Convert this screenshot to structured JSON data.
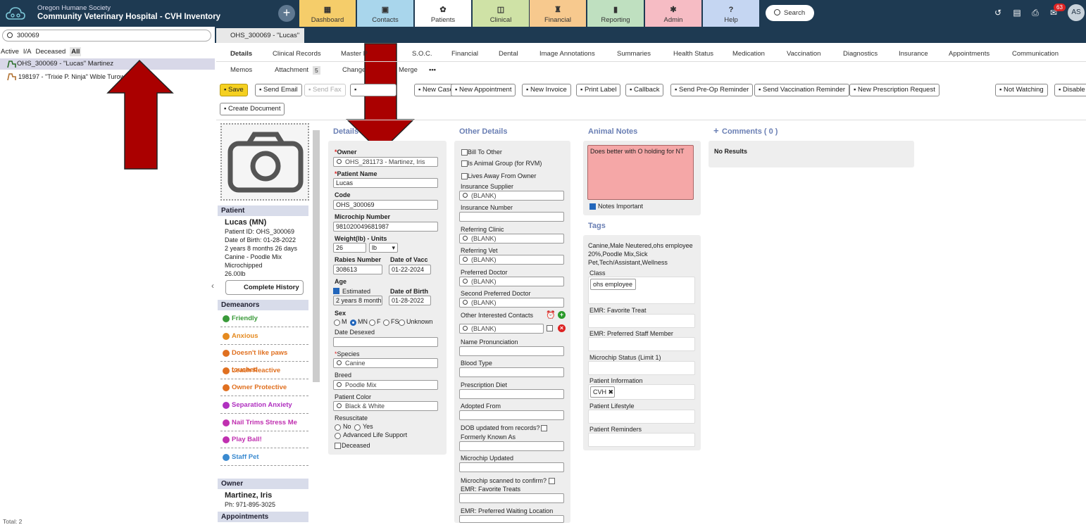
{
  "header": {
    "org": "Oregon Humane Society",
    "hospital": "Community Veterinary Hospital - CVH Inventory",
    "search_label": "Search",
    "badge": "63",
    "avatar": "AS"
  },
  "nav": [
    {
      "label": "Dashboard",
      "icon": "▦",
      "color": "#f5cd6a"
    },
    {
      "label": "Contacts",
      "icon": "▣",
      "color": "#a9d6ec"
    },
    {
      "label": "Patients",
      "icon": "✿",
      "color": "#ffffff"
    },
    {
      "label": "Clinical",
      "icon": "◫",
      "color": "#cfe2a6"
    },
    {
      "label": "Financial",
      "icon": "♜",
      "color": "#f7c98e"
    },
    {
      "label": "Reporting",
      "icon": "▮",
      "color": "#bfe0c0"
    },
    {
      "label": "Admin",
      "icon": "✱",
      "color": "#f6bcc4"
    },
    {
      "label": "Help",
      "icon": "?",
      "color": "#c5d6f2"
    }
  ],
  "left": {
    "search_value": "300069",
    "filters": [
      "Active",
      "I/A",
      "Deceased",
      "All"
    ],
    "results": [
      "OHS_300069 - \"Lucas\" Martinez",
      "198197 - \"Trixie P. Ninja\" Wible Turowski"
    ],
    "total": "Total: 2"
  },
  "patient_tab": "OHS_300069 - \"Lucas\" ...",
  "subtabs_row1": [
    "Details",
    "Clinical Records",
    "Master P",
    "S.O.C.",
    "Financial",
    "Dental",
    "Image Annotations",
    "Summaries",
    "Health Status",
    "Medication",
    "Vaccination",
    "Diagnostics",
    "Insurance",
    "Appointments",
    "Communication"
  ],
  "subtabs_row2": [
    "Memos",
    "Attachment",
    "5",
    "Change",
    "Merge",
    "•••"
  ],
  "toolbar": [
    "Save",
    "Send Email",
    "Send Fax",
    "",
    "New Case",
    "New Appointment",
    "New Invoice",
    "Print Label",
    "Callback",
    "Send Pre-Op Reminder",
    "Send Vaccination Reminder",
    "New Prescription Request",
    "Not Watching",
    "Disable",
    "Create Document"
  ],
  "patient": {
    "section": "Patient",
    "name": "Lucas (MN)",
    "id": "Patient ID: OHS_300069",
    "dob": "Date of Birth: 01-28-2022",
    "age": "2 years 8 months 26 days",
    "breed": "Canine - Poodle Mix",
    "chip": "Microchipped",
    "weight": "26.00lb",
    "history": "Complete History"
  },
  "demeanors": {
    "title": "Demeanors",
    "items": [
      {
        "label": "Friendly",
        "color": "#3a9a3a"
      },
      {
        "label": "Anxious",
        "color": "#e58a1f"
      },
      {
        "label": "Doesn't like paws touched",
        "color": "#e07020"
      },
      {
        "label": "Leash Reactive",
        "color": "#e07020"
      },
      {
        "label": "Owner Protective",
        "color": "#e07020"
      },
      {
        "label": "Separation Anxiety",
        "color": "#b030c0"
      },
      {
        "label": "Nail Trims Stress Me",
        "color": "#c030b0"
      },
      {
        "label": "Play Ball!",
        "color": "#c030b0"
      },
      {
        "label": "Staff Pet",
        "color": "#3a8ad0"
      }
    ]
  },
  "owner": {
    "section": "Owner",
    "name": "Martinez, Iris",
    "phone": "Ph: 971-895-3025",
    "appointments": "Appointments"
  },
  "details": {
    "title": "Details",
    "owner_label": "Owner",
    "owner_value": "OHS_281173 -  Martinez, Iris",
    "name_label": "Patient Name",
    "name_value": "Lucas",
    "code_label": "Code",
    "code_value": "OHS_300069",
    "chip_label": "Microchip Number",
    "chip_value": "981020049681987",
    "weight_label": "Weight(lb) - Units",
    "weight_value": "26",
    "unit_value": "lb",
    "rabies_label": "Rabies Number",
    "rabies_value": "308613",
    "vacc_label": "Date of Vacc",
    "vacc_value": "01-22-2024",
    "age_label": "Age",
    "estimated": "Estimated",
    "age_value": "2 years 8 months",
    "dob_label": "Date of Birth",
    "dob_value": "01-28-2022",
    "sex_label": "Sex",
    "sex": [
      "M",
      "MN",
      "F",
      "FS",
      "Unknown"
    ],
    "desexed_label": "Date Desexed",
    "species_label": "Species",
    "species_value": "Canine",
    "breed_label": "Breed",
    "breed_value": "Poodle Mix",
    "color_label": "Patient Color",
    "color_value": "Black & White",
    "resus_label": "Resuscitate",
    "no": "No",
    "yes": "Yes",
    "als": "Advanced Life Support",
    "deceased": "Deceased"
  },
  "other": {
    "title": "Other Details",
    "bill": "Bill To Other",
    "group": "Is Animal Group (for RVM)",
    "lives": "Lives Away From Owner",
    "ins_sup": "Insurance Supplier",
    "blank": "(BLANK)",
    "ins_num": "Insurance Number",
    "ref_clinic": "Referring Clinic",
    "ref_vet": "Referring Vet",
    "pref_doc": "Preferred Doctor",
    "second_doc": "Second Preferred Doctor",
    "contacts": "Other Interested Contacts",
    "pron": "Name Pronunciation",
    "blood": "Blood Type",
    "diet": "Prescription Diet",
    "adopted": "Adopted From",
    "dob_upd": "DOB updated from records?",
    "formerly": "Formerly Known As",
    "chip_upd": "Microchip Updated",
    "chip_scan": "Microchip scanned to confirm?",
    "fav_treats": "EMR: Favorite Treats",
    "wait_loc": "EMR: Preferred Waiting Location"
  },
  "notes": {
    "title": "Animal Notes",
    "text": "Does better with O holding for NT",
    "important": "Notes Important"
  },
  "tags": {
    "title": "Tags",
    "text": "Canine,Male Neutered,ohs employee 20%,Poodle Mix,Sick Pet,Tech/Assistant,Wellness",
    "class": "Class",
    "class_chip": "ohs employee",
    "fav_treat": "EMR: Favorite Treat",
    "staff": "EMR: Preferred Staff Member",
    "chip_status": "Microchip Status (Limit 1)",
    "pinfo": "Patient Information",
    "pinfo_chip": "CVH",
    "lifestyle": "Patient Lifestyle",
    "reminders": "Patient Reminders"
  },
  "comments": {
    "title": "Comments ( 0 )",
    "empty": "No Results"
  }
}
